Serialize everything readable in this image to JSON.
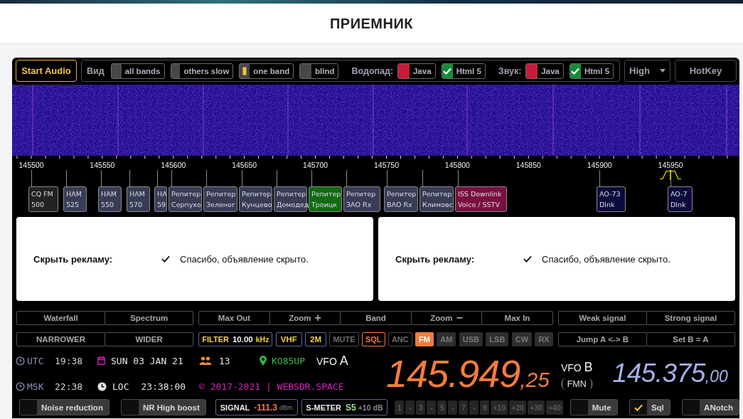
{
  "header": {
    "title": "ПРИЕМНИК"
  },
  "toolbar": {
    "start_audio": "Start Audio",
    "view": {
      "label": "Вид",
      "options": [
        {
          "label": "all bands",
          "selected": false
        },
        {
          "label": "others slow",
          "selected": false
        },
        {
          "label": "one band",
          "selected": true
        },
        {
          "label": "blind",
          "selected": false
        }
      ]
    },
    "engines": [
      {
        "label": "Водопад:",
        "options": [
          {
            "label": "Java",
            "checked": false
          },
          {
            "label": "Html 5",
            "checked": true
          }
        ]
      },
      {
        "label": "Звук:",
        "options": [
          {
            "label": "Java",
            "checked": false
          },
          {
            "label": "Html 5",
            "checked": true
          }
        ]
      }
    ],
    "quality": "High",
    "hotkey": "HotKey"
  },
  "scale": {
    "labels": [
      "145500",
      "145550",
      "145600",
      "145650",
      "145700",
      "145750",
      "145800",
      "145850",
      "145900",
      "145950"
    ],
    "markers": [
      {
        "lines": [
          "CQ FM",
          "500"
        ],
        "color": "#222222"
      },
      {
        "lines": [
          "HAM",
          "525"
        ],
        "color": "#383c56"
      },
      {
        "lines": [
          "HAM",
          "550"
        ],
        "color": "#383c56"
      },
      {
        "lines": [
          "HAM",
          "570"
        ],
        "color": "#383c56"
      },
      {
        "lines": [
          "HA",
          "59"
        ],
        "color": "#383c56"
      },
      {
        "lines": [
          "Репитер",
          "Серпухо"
        ],
        "color": "#383c56"
      },
      {
        "lines": [
          "Репитер",
          "Зеленог"
        ],
        "color": "#383c56"
      },
      {
        "lines": [
          "Репитер",
          "Кунцево"
        ],
        "color": "#383c56"
      },
      {
        "lines": [
          "Репитер",
          "Домодед"
        ],
        "color": "#383c56"
      },
      {
        "lines": [
          "Репитер",
          "Троицк"
        ],
        "color": "#106b12"
      },
      {
        "lines": [
          "Репитер",
          "ЗАО Rx"
        ],
        "color": "#383c56"
      },
      {
        "lines": [
          "Репитер",
          "ВАО Rx"
        ],
        "color": "#383c56"
      },
      {
        "lines": [
          "Репитер",
          "Климовс"
        ],
        "color": "#383c56"
      },
      {
        "lines": [
          "ISS Downlink",
          "Voice / SSTV"
        ],
        "color": "#7a1040"
      },
      {
        "lines": [
          "AO-73",
          "Dlnk"
        ],
        "color": "#0b0b3e"
      },
      {
        "lines": [
          "AO-7",
          "Dlnk"
        ],
        "color": "#0b0b3e"
      }
    ]
  },
  "ads": [
    {
      "label": "Скрыть рекламу:",
      "message": "Спасибо, объявление скрыто."
    },
    {
      "label": "Скрыть рекламу:",
      "message": "Спасибо, объявление скрыто."
    }
  ],
  "controls": {
    "display_buttons": [
      "Waterfall",
      "Spectrum"
    ],
    "zoom_buttons": [
      {
        "label": "Max Out"
      },
      {
        "label": "Zoom",
        "symbol": "+"
      },
      {
        "label": "Band"
      },
      {
        "label": "Zoom",
        "symbol": "−"
      },
      {
        "label": "Max In"
      }
    ],
    "signal_buttons": [
      "Weak signal",
      "Strong signal"
    ],
    "width_buttons": [
      "NARROWER",
      "WIDER"
    ],
    "row2_items": [
      {
        "kind": "filter",
        "label": "FILTER",
        "value": "10.00",
        "unit": "kHz"
      },
      {
        "kind": "band",
        "label": "VHF"
      },
      {
        "kind": "band",
        "label": "2M"
      },
      {
        "kind": "toggle",
        "label": "MUTE",
        "on": false
      },
      {
        "kind": "toggle",
        "label": "SQL",
        "on": true
      },
      {
        "kind": "toggle",
        "label": "ANC",
        "on": false
      },
      {
        "kind": "mode",
        "label": "FM",
        "selected": true
      },
      {
        "kind": "mode",
        "label": "AM",
        "selected": false
      },
      {
        "kind": "mode",
        "label": "USB",
        "selected": false
      },
      {
        "kind": "mode",
        "label": "LSB",
        "selected": false
      },
      {
        "kind": "mode",
        "label": "CW",
        "selected": false
      },
      {
        "kind": "mode",
        "label": "RX",
        "selected": false
      }
    ],
    "vfo_buttons": [
      "Jump A <-> B",
      "Set B = A"
    ]
  },
  "status": {
    "clocks": [
      {
        "zone": "UTC",
        "time": "19:38"
      },
      {
        "zone": "MSK",
        "time": "22:38"
      }
    ],
    "date": "SUN 03 JAN 21",
    "users": "13",
    "locator": "KO85UP",
    "vfo_a": {
      "label": "VFO",
      "letter": "A"
    },
    "local": {
      "zone": "LOC",
      "time": "23:38:00"
    },
    "copyright": "© 2017-2021 | WEBSDR.SPACE"
  },
  "frequency": {
    "main": "145.949",
    "fraction": ",25"
  },
  "vfo_b": {
    "label": "VFO",
    "letter": "B",
    "mode": "FMN"
  },
  "frequency_b": {
    "main": "145.375",
    "fraction": ",00"
  },
  "bottom": {
    "toggles_left": [
      {
        "label": "Noise reduction",
        "checked": false
      },
      {
        "label": "NR High boost",
        "checked": false
      }
    ],
    "signal": {
      "label": "SIGNAL",
      "value": "-111.3",
      "unit": "dBm"
    },
    "smeter": {
      "label": "S-METER",
      "value": "S5",
      "extra": "+10 dB"
    },
    "smeter_scale": [
      "1",
      "-",
      "3",
      "-",
      "5",
      "-",
      "7",
      "-",
      "9",
      "+10",
      "+20",
      "+30",
      "+40"
    ],
    "toggles_right": [
      {
        "label": "Mute",
        "checked": false
      },
      {
        "label": "Sql",
        "checked": true
      },
      {
        "label": "ANotch",
        "checked": false
      }
    ]
  }
}
